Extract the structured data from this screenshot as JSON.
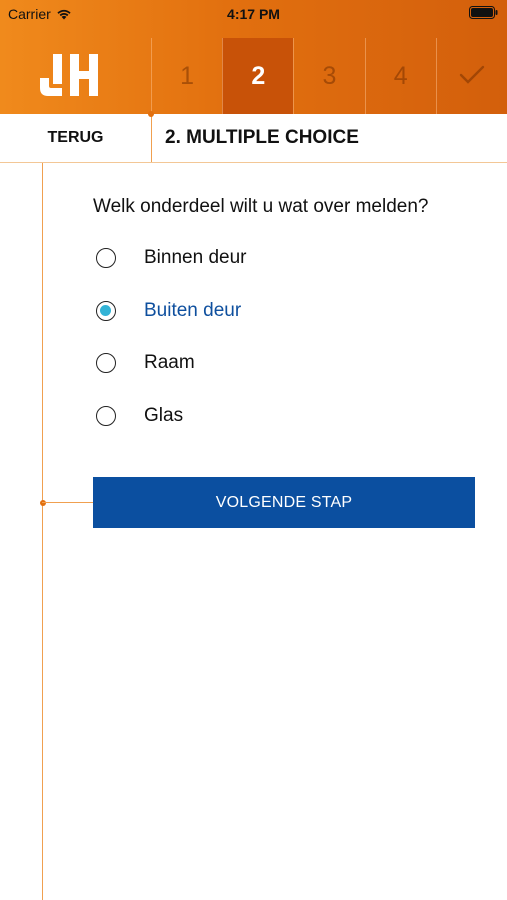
{
  "status_bar": {
    "carrier": "Carrier",
    "time": "4:17 PM"
  },
  "header": {
    "logo": "JH",
    "steps": [
      {
        "label": "1",
        "active": false
      },
      {
        "label": "2",
        "active": true
      },
      {
        "label": "3",
        "active": false
      },
      {
        "label": "4",
        "active": false
      }
    ],
    "final_step_icon": "checkmark-icon"
  },
  "subheader": {
    "back_label": "TERUG",
    "title": "2. MULTIPLE CHOICE"
  },
  "form": {
    "question": "Welk onderdeel wilt u wat over melden?",
    "options": [
      {
        "label": "Binnen deur",
        "selected": false
      },
      {
        "label": "Buiten deur",
        "selected": true
      },
      {
        "label": "Raam",
        "selected": false
      },
      {
        "label": "Glas",
        "selected": false
      }
    ],
    "next_button": "VOLGENDE STAP"
  },
  "colors": {
    "header_start": "#f08a1c",
    "header_end": "#d35f0c",
    "active_step": "#c85208",
    "primary_button": "#0b4fa0",
    "selected_text": "#0e4f9e",
    "radio_fill": "#32b3d6"
  }
}
